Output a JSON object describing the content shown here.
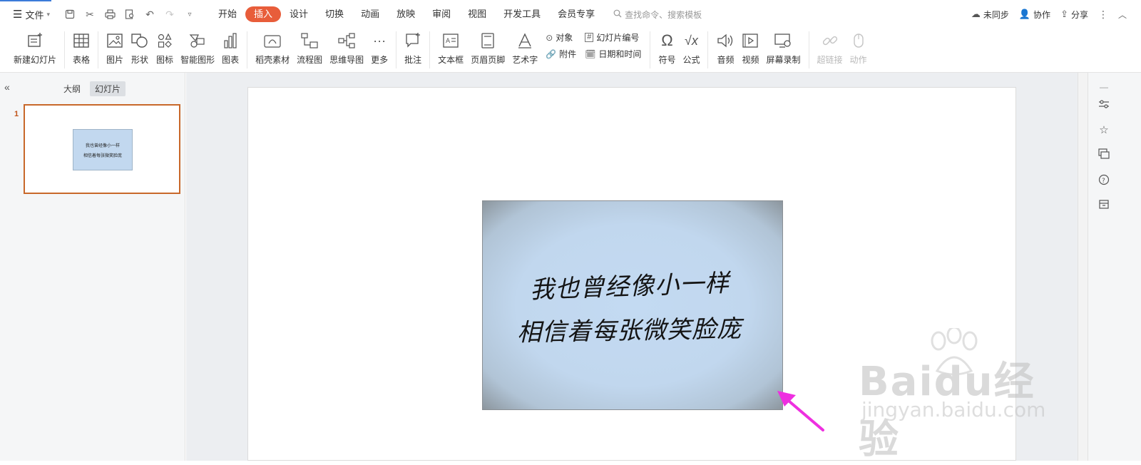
{
  "topbar": {
    "file_label": "文件",
    "menu_tabs": [
      "开始",
      "插入",
      "设计",
      "切换",
      "动画",
      "放映",
      "审阅",
      "视图",
      "开发工具",
      "会员专享"
    ],
    "active_tab": "插入",
    "search_placeholder": "查找命令、搜索模板",
    "sync_label": "未同步",
    "collab_label": "协作",
    "share_label": "分享"
  },
  "ribbon": {
    "new_slide": "新建幻灯片",
    "table": "表格",
    "picture": "图片",
    "shape": "形状",
    "icon": "图标",
    "smart_graphic": "智能图形",
    "chart": "图表",
    "shell_material": "稻壳素材",
    "flowchart": "流程图",
    "mindmap": "思维导图",
    "more": "更多",
    "comment": "批注",
    "textbox": "文本框",
    "header_footer": "页眉页脚",
    "wordart": "艺术字",
    "object": "对象",
    "attachment": "附件",
    "slide_number": "幻灯片编号",
    "date_time": "日期和时间",
    "symbol": "符号",
    "formula": "公式",
    "audio": "音频",
    "video": "视频",
    "screen_record": "屏幕录制",
    "hyperlink": "超链接",
    "action": "动作"
  },
  "left_panel": {
    "tab_outline": "大纲",
    "tab_slides": "幻灯片",
    "slide_number": "1"
  },
  "slide": {
    "line1": "我也曾经像小一样",
    "line2": "相信着每张微笑脸庞"
  },
  "watermark": {
    "main": "Baidu经验",
    "sub": "jingyan.baidu.com"
  },
  "colors": {
    "accent_tab": "#e85d3a",
    "thumb_border": "#c8682a",
    "arrow": "#ee2fe0",
    "photo_bg": "#c3daf2"
  }
}
